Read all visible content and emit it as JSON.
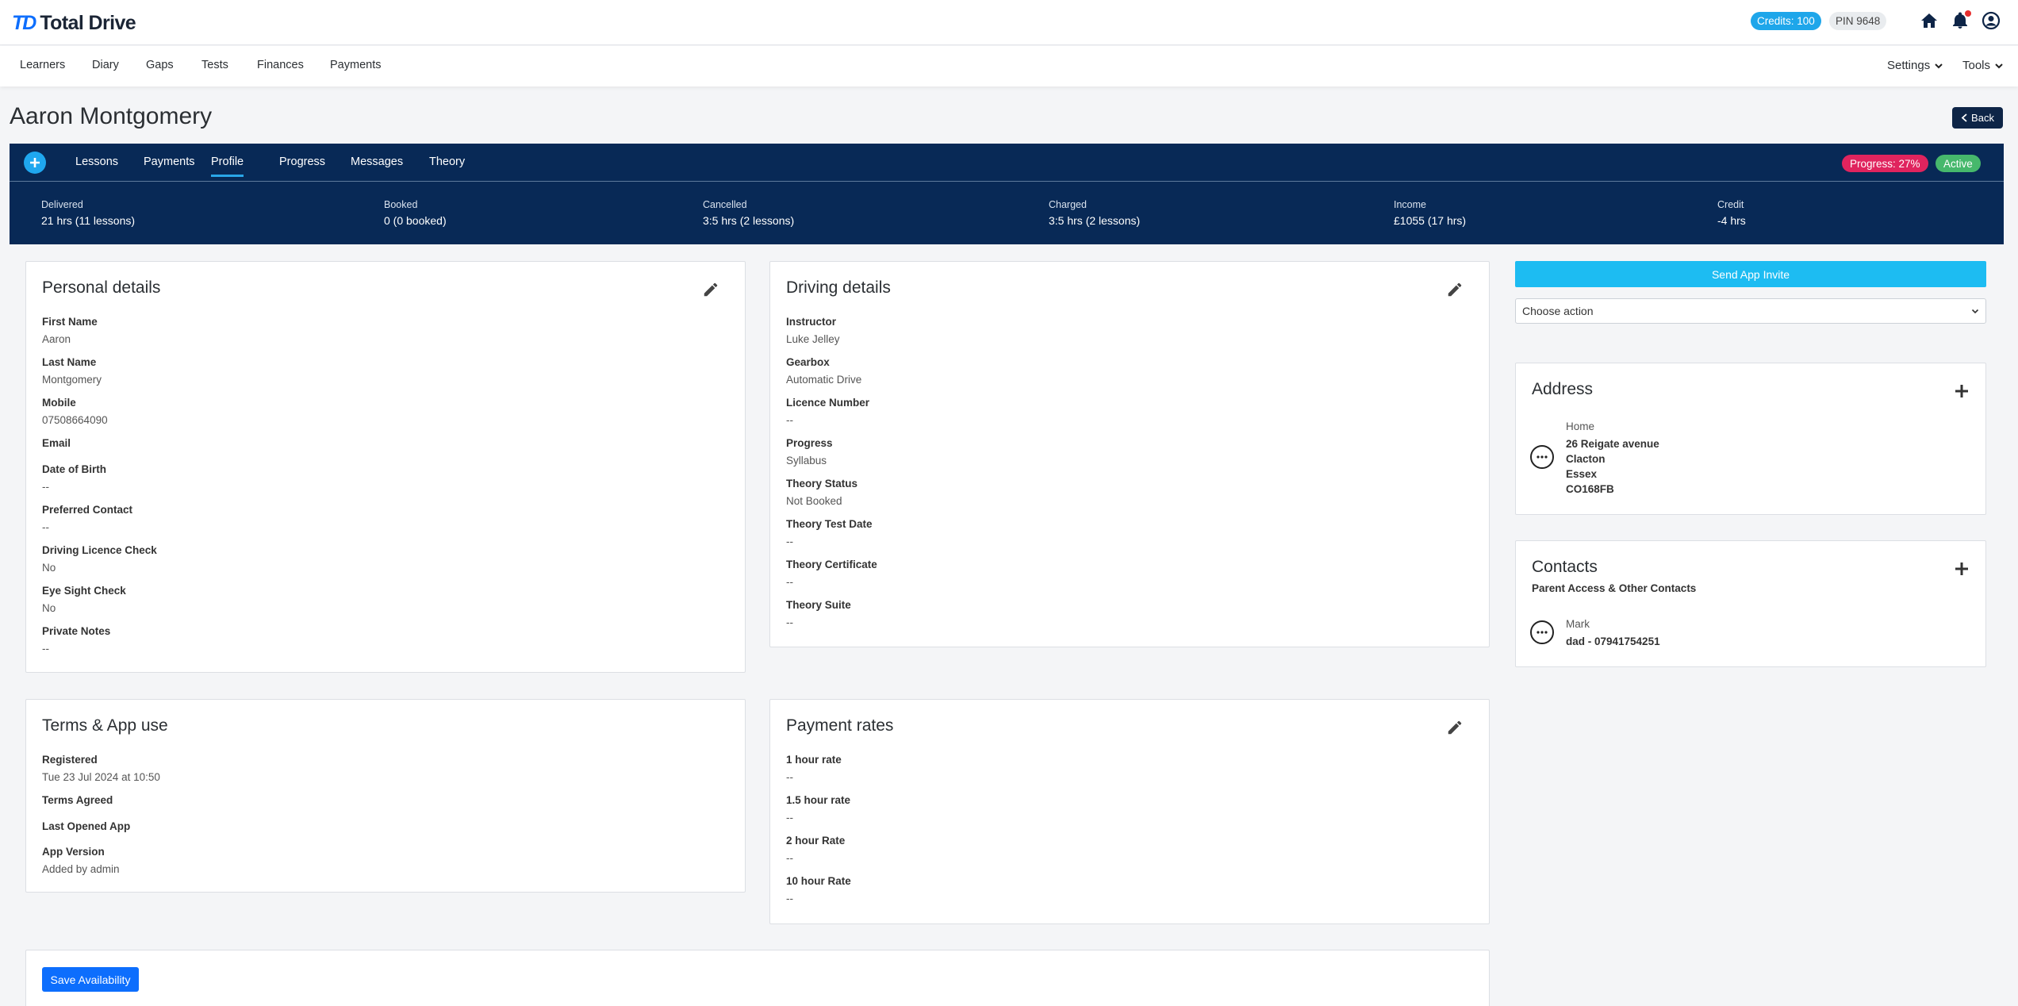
{
  "app": {
    "logo_mark": "TD",
    "logo_text": "Total Drive"
  },
  "topbar": {
    "credits": "Credits: 100",
    "pin": "PIN 9648"
  },
  "nav": {
    "items": [
      "Learners",
      "Diary",
      "Gaps",
      "Tests",
      "Finances",
      "Payments"
    ],
    "settings": "Settings",
    "tools": "Tools"
  },
  "page": {
    "title": "Aaron Montgomery",
    "back": "Back"
  },
  "learner_tabs": {
    "items": [
      "Lessons",
      "Payments",
      "Profile",
      "Progress",
      "Messages",
      "Theory"
    ],
    "active": "Profile",
    "progress_badge": "Progress: 27%",
    "status_badge": "Active"
  },
  "stats": [
    {
      "label": "Delivered",
      "value": "21 hrs (11 lessons)"
    },
    {
      "label": "Booked",
      "value": "0 (0 booked)"
    },
    {
      "label": "Cancelled",
      "value": "3:5 hrs (2 lessons)"
    },
    {
      "label": "Charged",
      "value": "3:5 hrs (2 lessons)"
    },
    {
      "label": "Income",
      "value": "£1055 (17 hrs)"
    },
    {
      "label": "Credit",
      "value": "-4 hrs"
    }
  ],
  "personal": {
    "title": "Personal details",
    "fields": [
      {
        "label": "First Name",
        "value": "Aaron"
      },
      {
        "label": "Last Name",
        "value": "Montgomery"
      },
      {
        "label": "Mobile",
        "value": "07508664090"
      },
      {
        "label": "Email",
        "value": ""
      },
      {
        "label": "Date of Birth",
        "value": "--"
      },
      {
        "label": "Preferred Contact",
        "value": "--"
      },
      {
        "label": "Driving Licence Check",
        "value": "No"
      },
      {
        "label": "Eye Sight Check",
        "value": "No"
      },
      {
        "label": "Private Notes",
        "value": "--"
      }
    ]
  },
  "driving": {
    "title": "Driving details",
    "fields": [
      {
        "label": "Instructor",
        "value": "Luke Jelley"
      },
      {
        "label": "Gearbox",
        "value": "Automatic Drive"
      },
      {
        "label": "Licence Number",
        "value": "--"
      },
      {
        "label": "Progress",
        "value": "Syllabus"
      },
      {
        "label": "Theory Status",
        "value": "Not Booked"
      },
      {
        "label": "Theory Test Date",
        "value": "--"
      },
      {
        "label": "Theory Certificate",
        "value": "--"
      },
      {
        "label": "Theory Suite",
        "value": "--"
      }
    ]
  },
  "terms": {
    "title": "Terms & App use",
    "fields": [
      {
        "label": "Registered",
        "value": "Tue 23 Jul 2024 at 10:50"
      },
      {
        "label": "Terms Agreed",
        "value": ""
      },
      {
        "label": "Last Opened App",
        "value": ""
      },
      {
        "label": "App Version",
        "value": "Added by admin"
      }
    ]
  },
  "rates": {
    "title": "Payment rates",
    "fields": [
      {
        "label": "1 hour rate",
        "value": "--"
      },
      {
        "label": "1.5 hour rate",
        "value": "--"
      },
      {
        "label": "2 hour Rate",
        "value": "--"
      },
      {
        "label": "10 hour Rate",
        "value": "--"
      }
    ]
  },
  "actions": {
    "send_invite": "Send App Invite",
    "choose_action": "Choose action"
  },
  "address": {
    "title": "Address",
    "type": "Home",
    "line1": "26 Reigate avenue",
    "line2": "Clacton",
    "line3": "Essex",
    "postcode": "CO168FB"
  },
  "contacts": {
    "title": "Contacts",
    "subtitle": "Parent Access & Other Contacts",
    "name": "Mark",
    "detail": "dad - 07941754251"
  },
  "availability": {
    "save": "Save Availability"
  },
  "colors": {
    "navy": "#082956",
    "accent": "#1fa7ef",
    "progress": "#e0245e",
    "active": "#46b86c",
    "primary": "#0d6efd"
  }
}
